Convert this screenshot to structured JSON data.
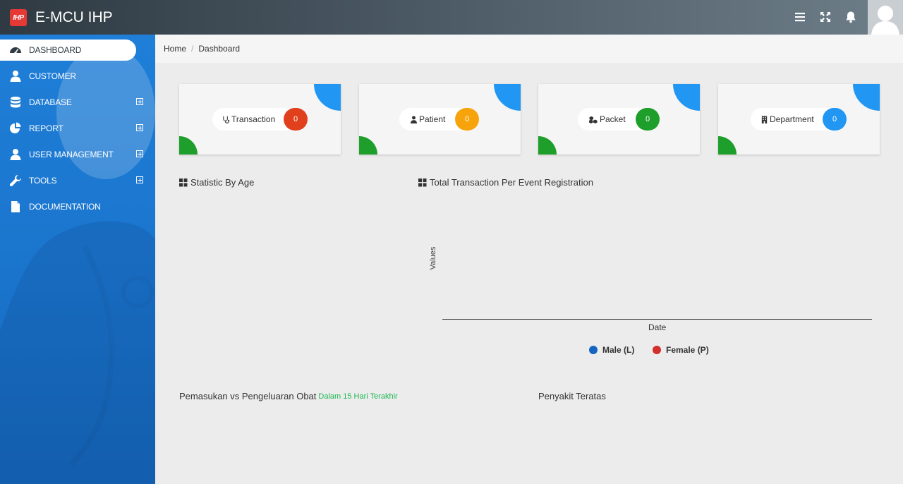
{
  "app": {
    "logo_text": "IHP",
    "title": "E-MCU IHP"
  },
  "sidebar": {
    "items": [
      {
        "label": "DASHBOARD",
        "icon": "dashboard-icon",
        "active": true
      },
      {
        "label": "CUSTOMER",
        "icon": "user-icon"
      },
      {
        "label": "DATABASE",
        "icon": "database-icon",
        "expandable": true
      },
      {
        "label": "REPORT",
        "icon": "pie-chart-icon",
        "expandable": true
      },
      {
        "label": "USER MANAGEMENT",
        "icon": "user-icon",
        "expandable": true
      },
      {
        "label": "TOOLS",
        "icon": "wrench-icon",
        "expandable": true
      },
      {
        "label": "DOCUMENTATION",
        "icon": "document-icon"
      }
    ]
  },
  "breadcrumb": {
    "home": "Home",
    "current": "Dashboard"
  },
  "cards": [
    {
      "label": "Transaction",
      "icon": "stethoscope-icon",
      "count": "0",
      "color": "#e0401b"
    },
    {
      "label": "Patient",
      "icon": "user-icon",
      "count": "0",
      "color": "#f7a30c"
    },
    {
      "label": "Packet",
      "icon": "cubes-icon",
      "count": "0",
      "color": "#1e9e2a"
    },
    {
      "label": "Department",
      "icon": "building-icon",
      "count": "0",
      "color": "#2196f3"
    }
  ],
  "sections": {
    "age": "Statistic By Age",
    "transaction": "Total Transaction Per Event Registration",
    "medicine": "Pemasukan vs Pengeluaran Obat",
    "medicine_sub": "Dalam 15 Hari Terakhir",
    "disease": "Penyakit Teratas"
  },
  "chart_data": {
    "type": "line",
    "title": "Total Transaction Per Event Registration",
    "xlabel": "Date",
    "ylabel": "Values",
    "x": [],
    "series": [
      {
        "name": "Male (L)",
        "values": [],
        "color": "#1565c0"
      },
      {
        "name": "Female (P)",
        "values": [],
        "color": "#d32f2f"
      }
    ],
    "legend": "bottom"
  }
}
